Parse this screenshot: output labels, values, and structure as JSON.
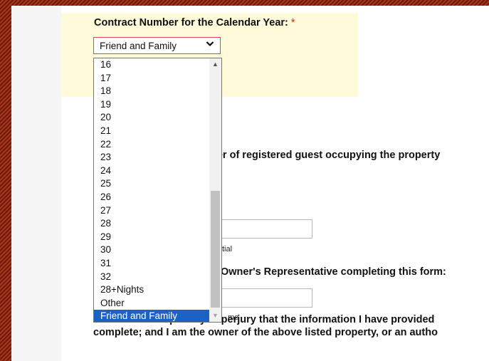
{
  "form": {
    "question_label": "Contract Number for the Calendar Year:",
    "required_marker": "*",
    "select_value": "Friend and Family",
    "select_chevron": "⌄",
    "dropdown_options": [
      "16",
      "17",
      "18",
      "19",
      "20",
      "21",
      "22",
      "23",
      "24",
      "25",
      "26",
      "27",
      "28",
      "29",
      "30",
      "31",
      "32",
      "28+Nights",
      "Other",
      "Friend and Family"
    ],
    "selected_option": "Friend and Family",
    "guest_fragment": "ber of registered guest occupying the property",
    "initial_fragment": "tial",
    "rep_fragment": "Owner's Representative completing this form:",
    "name_fragment": "me",
    "declaration_line1": "I declare under penalty of perjury that the information I have provided",
    "declaration_line2": "complete; and I am the owner of the above listed property, or an autho"
  },
  "scrollbar": {
    "up_arrow": "▲",
    "down_arrow": "▼"
  },
  "colors": {
    "highlight": "#fdfbd9",
    "selected": "#1a63c6",
    "required": "#d8281a",
    "select_border": "#d64a4a"
  }
}
